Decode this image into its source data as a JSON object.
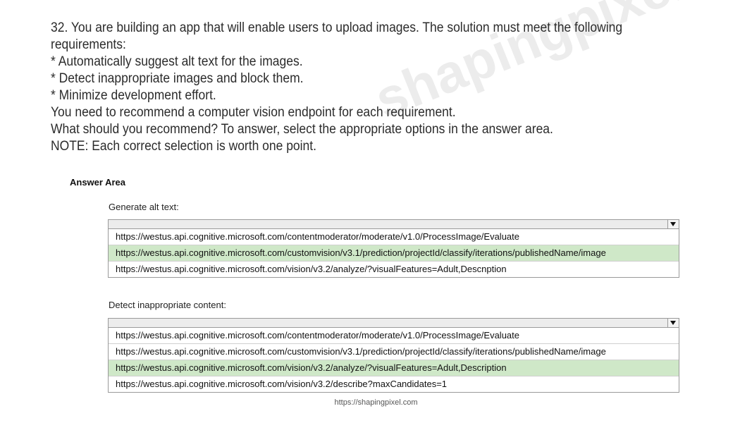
{
  "watermark": "shapingpixel.com",
  "question": {
    "lines": [
      "32. You are building an app that will enable users to upload images. The solution must meet the following",
      "requirements:",
      "* Automatically suggest alt text for the images.",
      "* Detect inappropriate images and block them.",
      "* Minimize development effort.",
      "You need to recommend a computer vision endpoint for each requirement.",
      "What should you recommend? To answer, select the appropriate options in the answer area.",
      "NOTE: Each correct selection is worth one point."
    ]
  },
  "answer_area": {
    "title": "Answer Area",
    "groups": [
      {
        "label": "Generate alt text:",
        "options": [
          "https://westus.api.cognitive.microsoft.com/contentmoderator/moderate/v1.0/ProcessImage/Evaluate",
          "https://westus.api.cognitive.microsoft.com/customvision/v3.1/prediction/projectId/classify/iterations/publishedName/image",
          "https://westus.api.cognitive.microsoft.com/vision/v3.2/analyze/?visualFeatures=Adult,Descnption"
        ],
        "selected_index": 1
      },
      {
        "label": "Detect inappropriate content:",
        "options": [
          "https://westus.api.cognitive.microsoft.com/contentmoderator/moderate/v1.0/ProcessImage/Evaluate",
          "https://westus.api.cognitive.microsoft.com/customvision/v3.1/prediction/projectId/classify/iterations/publishedName/image",
          "https://westus.api.cognitive.microsoft.com/vision/v3.2/analyze/?visualFeatures=Adult,Description",
          "https://westus.api.cognitive.microsoft.com/vision/v3.2/describe?maxCandidates=1"
        ],
        "selected_index": 2
      }
    ]
  },
  "footer": {
    "url": "https://shapingpixel.com"
  },
  "colors": {
    "selected_row": "#cfe8c8"
  }
}
